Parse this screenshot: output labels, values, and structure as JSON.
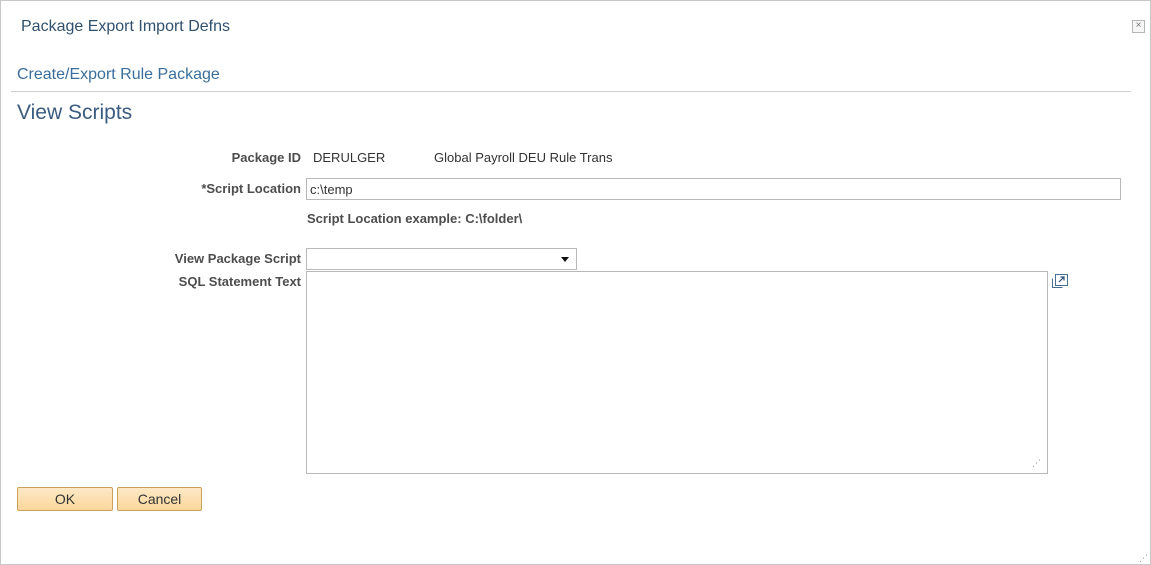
{
  "dialog": {
    "title": "Package Export Import Defns",
    "close_symbol": "×"
  },
  "page": {
    "subtitle": "Create/Export Rule Package",
    "heading": "View Scripts"
  },
  "form": {
    "package_id": {
      "label": "Package ID",
      "value": "DERULGER",
      "description": "Global Payroll DEU Rule Trans"
    },
    "script_location": {
      "label": "*Script Location",
      "value": "c:\\temp",
      "hint": "Script Location example: C:\\folder\\"
    },
    "view_package_script": {
      "label": "View Package Script",
      "selected": ""
    },
    "sql_statement_text": {
      "label": "SQL Statement Text",
      "value": ""
    }
  },
  "buttons": {
    "ok": "OK",
    "cancel": "Cancel"
  },
  "icons": {
    "close": "close-icon",
    "expand": "expand-icon",
    "resize": "resize-grip-icon",
    "dropdown": "chevron-down-icon"
  }
}
